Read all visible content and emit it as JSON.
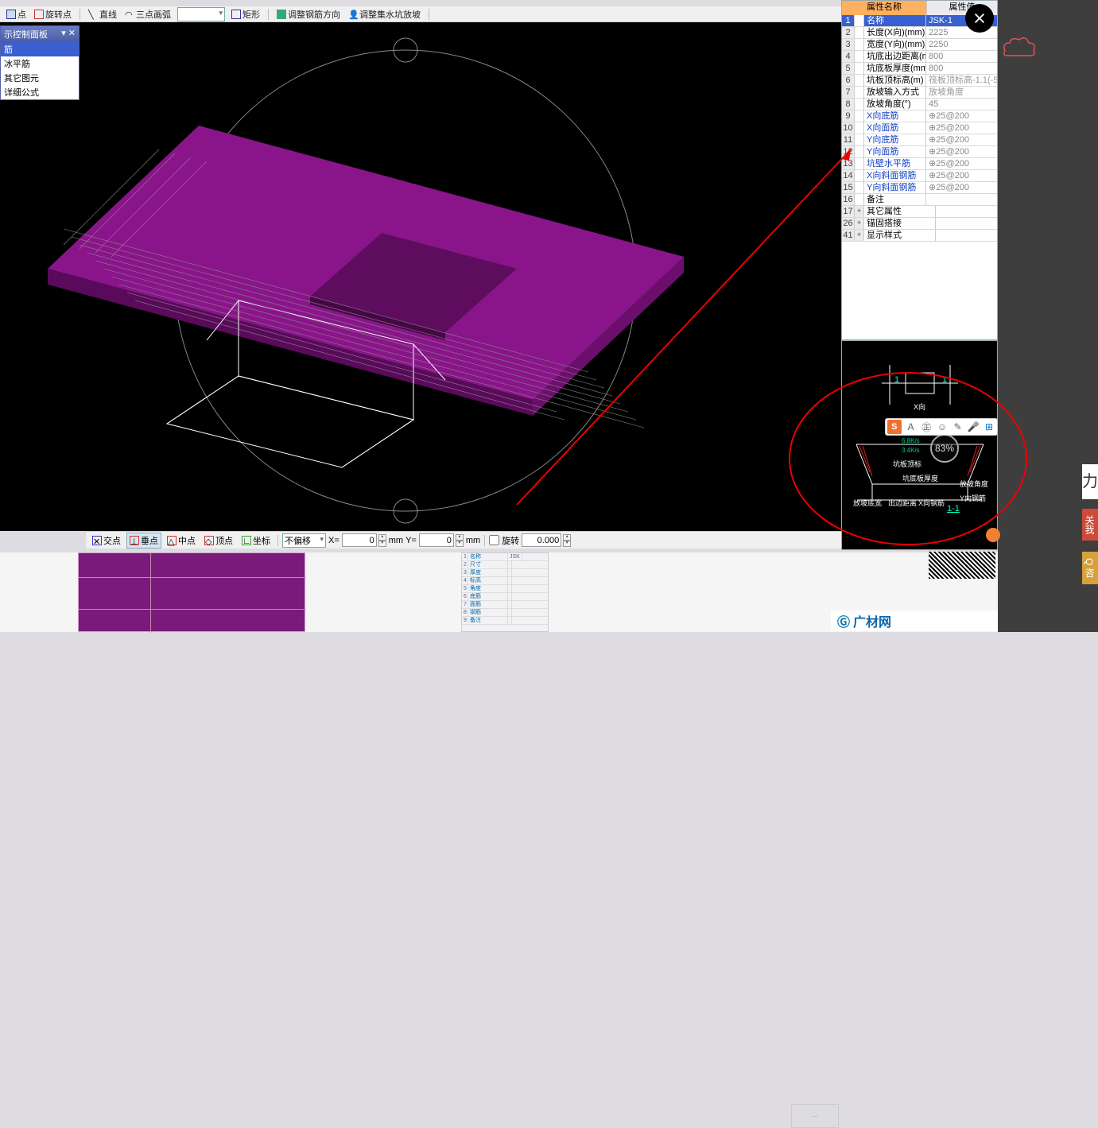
{
  "toolbar": {
    "btn_point": "点",
    "btn_rotate_point": "旋转点",
    "btn_line": "直线",
    "btn_arc3": "三点画弧",
    "btn_rect": "矩形",
    "btn_adjust_rebar_dir": "调整钢筋方向",
    "btn_adjust_sump_slope": "调整集水坑放坡",
    "arc_combo_value": ""
  },
  "tree_panel": {
    "title": "示控制面板",
    "items": [
      "筋",
      "冰平筋",
      "其它图元",
      "详细公式"
    ]
  },
  "snap_bar": {
    "jiaodian": "交点",
    "chuidian": "垂点",
    "zhongdian": "中点",
    "dingdian": "顶点",
    "zuobiao": "坐标",
    "offset_mode": "不偏移",
    "x_label": "X=",
    "x_value": "0",
    "x_unit": "mm",
    "y_label": "Y=",
    "y_value": "0",
    "y_unit": "mm",
    "rotate_label": "旋转",
    "rotate_value": "0.000"
  },
  "property_panel": {
    "header_name": "属性名称",
    "header_value": "属性值",
    "rows": [
      {
        "n": "1",
        "name": "名称",
        "val": "JSK-1",
        "link": false,
        "sel": true
      },
      {
        "n": "2",
        "name": "长度(X向)(mm)",
        "val": "2225",
        "link": false
      },
      {
        "n": "3",
        "name": "宽度(Y向)(mm)",
        "val": "2250",
        "link": false
      },
      {
        "n": "4",
        "name": "坑底出边距离(mm)",
        "val": "800",
        "link": false
      },
      {
        "n": "5",
        "name": "坑底板厚度(mm)",
        "val": "800",
        "link": false
      },
      {
        "n": "6",
        "name": "坑板顶标高(m)",
        "val": "筏板顶标高-1.1(-5.",
        "link": false,
        "grey": true
      },
      {
        "n": "7",
        "name": "放坡输入方式",
        "val": "放坡角度",
        "link": false,
        "grey": true
      },
      {
        "n": "8",
        "name": "放坡角度(°)",
        "val": "45",
        "link": false
      },
      {
        "n": "9",
        "name": "X向底筋",
        "val": "⊕25@200",
        "link": true
      },
      {
        "n": "10",
        "name": "X向面筋",
        "val": "⊕25@200",
        "link": true
      },
      {
        "n": "11",
        "name": "Y向底筋",
        "val": "⊕25@200",
        "link": true
      },
      {
        "n": "12",
        "name": "Y向面筋",
        "val": "⊕25@200",
        "link": true
      },
      {
        "n": "13",
        "name": "坑壁水平筋",
        "val": "⊕25@200",
        "link": true,
        "arrow": true
      },
      {
        "n": "14",
        "name": "X向斜面钢筋",
        "val": "⊕25@200",
        "link": true
      },
      {
        "n": "15",
        "name": "Y向斜面钢筋",
        "val": "⊕25@200",
        "link": true
      },
      {
        "n": "16",
        "name": "备注",
        "val": "",
        "link": false
      },
      {
        "n": "17",
        "name": "其它属性",
        "val": "",
        "link": false,
        "exp": "+"
      },
      {
        "n": "26",
        "name": "锚固搭接",
        "val": "",
        "link": false,
        "exp": "+"
      },
      {
        "n": "41",
        "name": "显示样式",
        "val": "",
        "link": false,
        "exp": "+"
      }
    ]
  },
  "diagram": {
    "top_left": "1",
    "top_right": "1",
    "top_mid": "X向",
    "section_label": "1-1",
    "d_slope_bottom": "放坡底宽",
    "d_out_dist": "出边距离",
    "d_x_rebar": "X向钢筋",
    "d_y_rebar": "Y向钢筋",
    "d_thickness": "坑底板厚度",
    "d_angle": "放坡角度",
    "d_top": "坑板顶标"
  },
  "gauge": {
    "pct": "83%",
    "up": "6.8K/s",
    "down": "3.4K/s"
  },
  "ime": {
    "letter": "A",
    "zh": "中"
  },
  "right_tabs": {
    "t1": "关我",
    "t2": "Q 咨"
  },
  "bottom": {
    "text_label": ""
  },
  "logo_text": "广材网",
  "cloud_text": "χ"
}
